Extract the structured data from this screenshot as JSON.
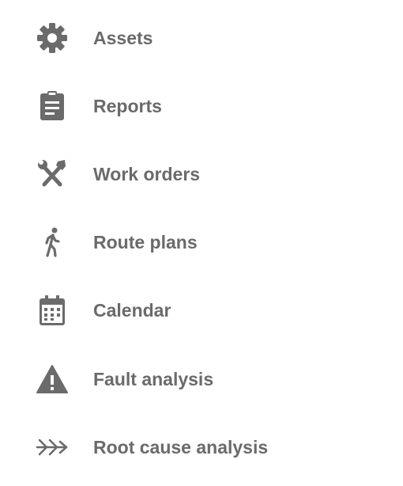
{
  "nav": {
    "items": [
      {
        "label": "Assets",
        "icon": "gear-icon"
      },
      {
        "label": "Reports",
        "icon": "clipboard-icon"
      },
      {
        "label": "Work orders",
        "icon": "tools-icon"
      },
      {
        "label": "Route plans",
        "icon": "walking-person-icon"
      },
      {
        "label": "Calendar",
        "icon": "calendar-icon"
      },
      {
        "label": "Fault analysis",
        "icon": "warning-icon"
      },
      {
        "label": "Root cause analysis",
        "icon": "double-arrow-icon"
      }
    ]
  },
  "colors": {
    "icon": "#6b6b6b",
    "text": "#6a6a6a",
    "background": "#ffffff"
  }
}
